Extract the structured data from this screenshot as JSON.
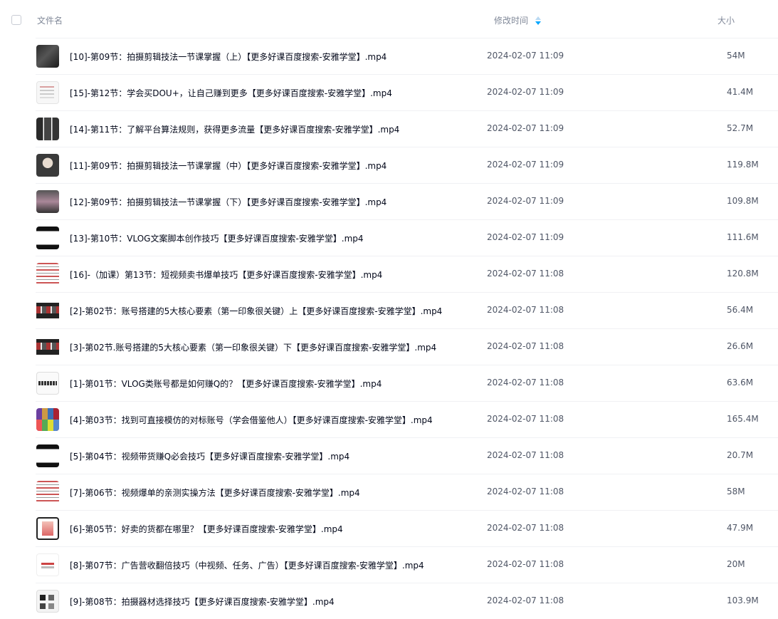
{
  "header": {
    "name_label": "文件名",
    "time_label": "修改时间",
    "size_label": "大小"
  },
  "colors": {
    "accent": "#06a7ff",
    "header_text": "#818999",
    "row_text": "#03081a",
    "meta_text": "#4f5666"
  },
  "files": [
    {
      "name": "[10]-第09节：拍摄剪辑技法一节课掌握（上）【更多好课百度搜索-安雅学堂】.mp4",
      "time": "2024-02-07 11:09",
      "size": "54M",
      "thumb": "t-dark"
    },
    {
      "name": "[15]-第12节：学会买DOU+，让自己赚到更多【更多好课百度搜索-安雅学堂】.mp4",
      "time": "2024-02-07 11:09",
      "size": "41.4M",
      "thumb": "t-doc"
    },
    {
      "name": "[14]-第11节：了解平台算法规则，获得更多流量【更多好课百度搜索-安雅学堂】.mp4",
      "time": "2024-02-07 11:09",
      "size": "52.7M",
      "thumb": "t-grid"
    },
    {
      "name": "[11]-第09节：拍摄剪辑技法一节课掌握（中）【更多好课百度搜索-安雅学堂】.mp4",
      "time": "2024-02-07 11:09",
      "size": "119.8M",
      "thumb": "t-person"
    },
    {
      "name": "[12]-第09节：拍摄剪辑技法一节课掌握（下）【更多好课百度搜索-安雅学堂】.mp4",
      "time": "2024-02-07 11:09",
      "size": "109.8M",
      "thumb": "t-photo"
    },
    {
      "name": "[13]-第10节：VLOG文案脚本创作技巧【更多好课百度搜索-安雅学堂】.mp4",
      "time": "2024-02-07 11:09",
      "size": "111.6M",
      "thumb": "t-page"
    },
    {
      "name": "[16]-（加课）第13节：短视频卖书爆单技巧【更多好课百度搜索-安雅学堂】.mp4",
      "time": "2024-02-07 11:08",
      "size": "120.8M",
      "thumb": "t-text"
    },
    {
      "name": "[2]-第02节：账号搭建的5大核心要素（第一印象很关键）上【更多好课百度搜索-安雅学堂】.mp4",
      "time": "2024-02-07 11:08",
      "size": "56.4M",
      "thumb": "t-strip"
    },
    {
      "name": "[3]-第02节.账号搭建的5大核心要素（第一印象很关键）下【更多好课百度搜索-安雅学堂】.mp4",
      "time": "2024-02-07 11:08",
      "size": "26.6M",
      "thumb": "t-strip"
    },
    {
      "name": "[1]-第01节：VLOG类账号都是如何赚Q的？【更多好课百度搜索-安雅学堂】.mp4",
      "time": "2024-02-07 11:08",
      "size": "63.6M",
      "thumb": "t-banner"
    },
    {
      "name": "[4]-第03节：找到可直接模仿的对标账号（学会借鉴他人）【更多好课百度搜索-安雅学堂】.mp4",
      "time": "2024-02-07 11:08",
      "size": "165.4M",
      "thumb": "t-color"
    },
    {
      "name": "[5]-第04节：视频带货赚Q必会技巧【更多好课百度搜索-安雅学堂】.mp4",
      "time": "2024-02-07 11:08",
      "size": "20.7M",
      "thumb": "t-page"
    },
    {
      "name": "[7]-第06节：视频爆单的亲测实操方法【更多好课百度搜索-安雅学堂】.mp4",
      "time": "2024-02-07 11:08",
      "size": "58M",
      "thumb": "t-text"
    },
    {
      "name": "[6]-第05节：好卖的货都在哪里？【更多好课百度搜索-安雅学堂】.mp4",
      "time": "2024-02-07 11:08",
      "size": "47.9M",
      "thumb": "t-phone"
    },
    {
      "name": "[8]-第07节：广告营收翻倍技巧（中视频、任务、广告）【更多好课百度搜索-安雅学堂】.mp4",
      "time": "2024-02-07 11:08",
      "size": "20M",
      "thumb": "t-light"
    },
    {
      "name": "[9]-第08节：拍摄器材选择技巧【更多好课百度搜索-安雅学堂】.mp4",
      "time": "2024-02-07 11:08",
      "size": "103.9M",
      "thumb": "t-items"
    }
  ]
}
